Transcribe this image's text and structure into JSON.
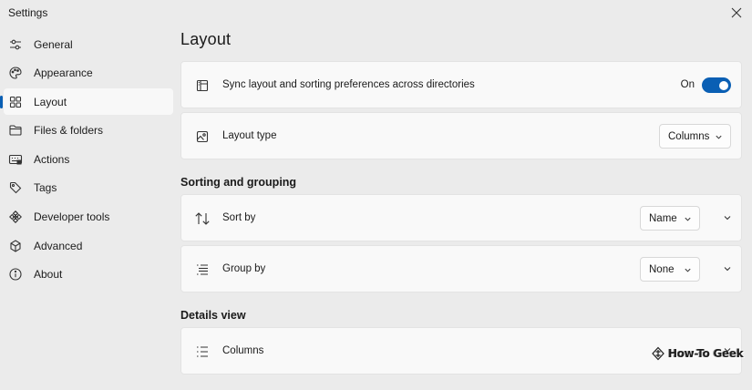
{
  "window": {
    "title": "Settings"
  },
  "sidebar": {
    "items": [
      {
        "label": "General",
        "icon": "sliders-icon"
      },
      {
        "label": "Appearance",
        "icon": "palette-icon"
      },
      {
        "label": "Layout",
        "icon": "grid-icon",
        "active": true
      },
      {
        "label": "Files & folders",
        "icon": "folder-icon"
      },
      {
        "label": "Actions",
        "icon": "keyboard-icon"
      },
      {
        "label": "Tags",
        "icon": "tag-icon"
      },
      {
        "label": "Developer tools",
        "icon": "puzzle-icon"
      },
      {
        "label": "Advanced",
        "icon": "beaker-icon"
      },
      {
        "label": "About",
        "icon": "info-icon"
      }
    ]
  },
  "main": {
    "title": "Layout",
    "sync": {
      "label": "Sync layout and sorting preferences across directories",
      "state_text": "On",
      "enabled": true
    },
    "layout_type": {
      "label": "Layout type",
      "value": "Columns"
    },
    "sorting_section": {
      "title": "Sorting and grouping"
    },
    "sort_by": {
      "label": "Sort by",
      "value": "Name"
    },
    "group_by": {
      "label": "Group by",
      "value": "None"
    },
    "details_section": {
      "title": "Details view"
    },
    "columns": {
      "label": "Columns"
    }
  },
  "watermark": {
    "text": "How-To Geek"
  },
  "colors": {
    "accent": "#0a5fb4",
    "background": "#ebebeb",
    "card": "#f9f9f9"
  }
}
